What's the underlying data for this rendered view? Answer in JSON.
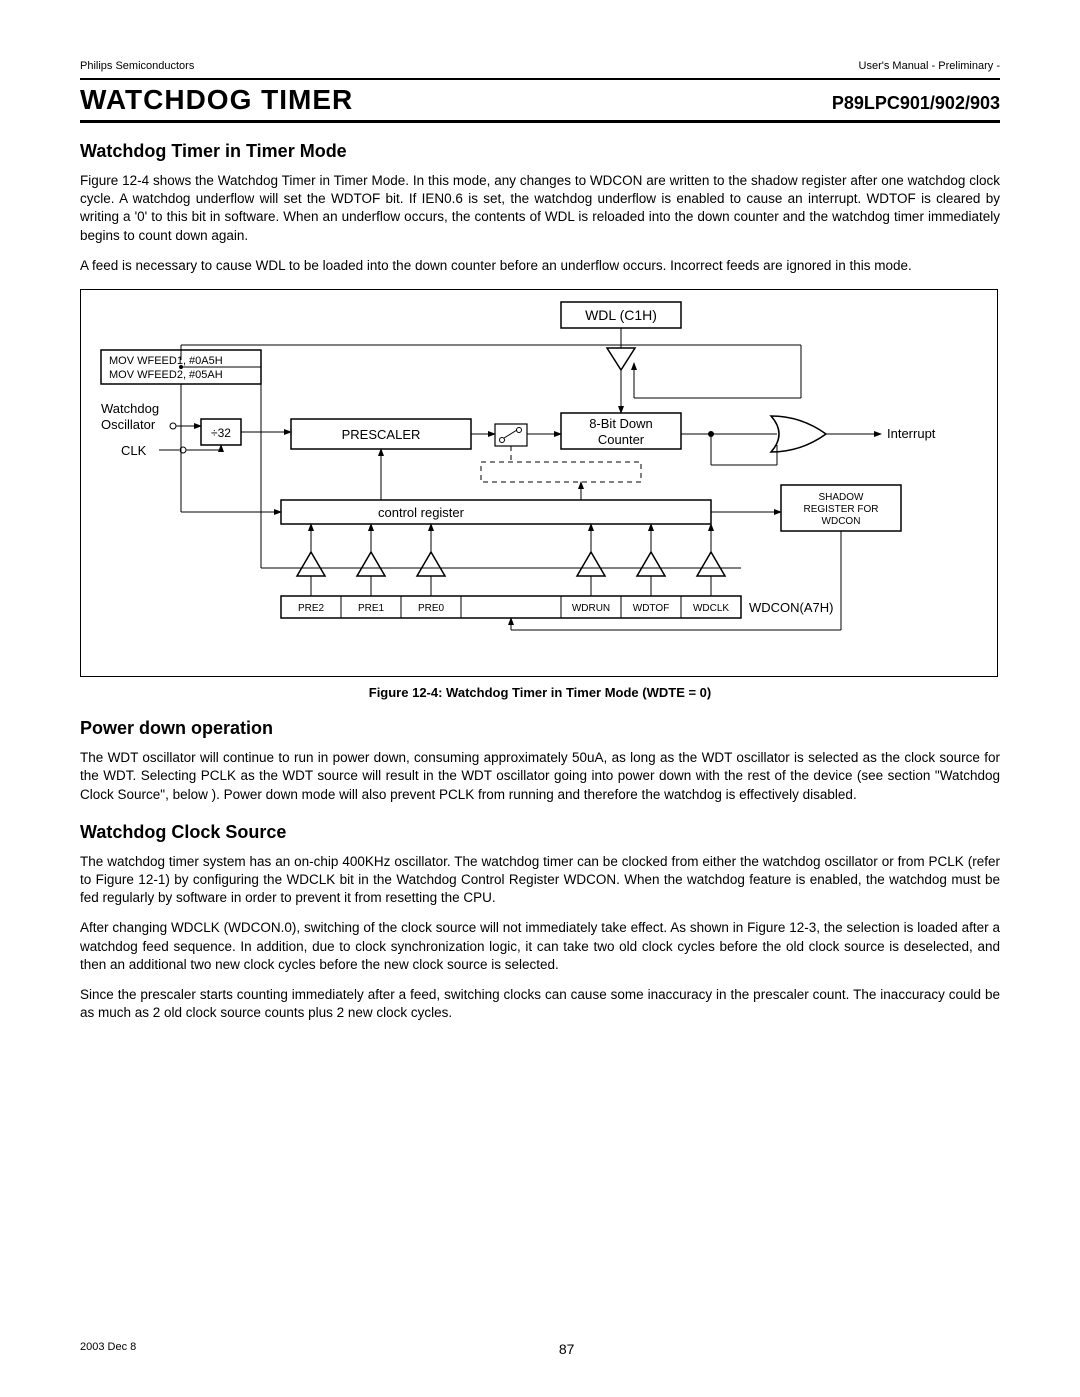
{
  "header": {
    "left": "Philips Semiconductors",
    "right": "User's Manual - Preliminary -"
  },
  "titlebar": {
    "main": "WATCHDOG TIMER",
    "part": "P89LPC901/902/903"
  },
  "sections": {
    "s1_title": "Watchdog Timer in Timer Mode",
    "s1_p1": "Figure 12-4 shows the Watchdog Timer in Timer Mode. In this mode, any changes to WDCON are written to the shadow register after one watchdog clock cycle. A watchdog underflow will set the WDTOF bit. If IEN0.6 is set, the watchdog underflow is enabled to cause an interrupt. WDTOF is cleared by writing a '0' to this bit in software. When an underflow occurs, the contents of WDL is reloaded into the down counter and the watchdog timer immediately begins to count down again.",
    "s1_p2": "A feed is necessary to cause WDL to be loaded into the down counter before an underflow occurs. Incorrect feeds are ignored in this mode.",
    "fig_caption": "Figure 12-4: Watchdog Timer in Timer Mode (WDTE = 0)",
    "s2_title": "Power down operation",
    "s2_p1": "The WDT oscillator will continue to run in power down, consuming approximately 50uA, as long as the WDT oscillator is selected as the clock source for the WDT.  Selecting PCLK as the WDT source will result in the WDT oscillator going into power down with the rest of the device (see section \"Watchdog Clock Source\", below ). Power down mode will also prevent PCLK from running and therefore the watchdog is effectively disabled.",
    "s3_title": "Watchdog Clock Source",
    "s3_p1": "The watchdog timer system has an on-chip 400KHz oscillator. The watchdog timer can be clocked from either the watchdog oscillator or from PCLK (refer to Figure 12-1) by configuring the WDCLK bit in the Watchdog Control Register WDCON. When the watchdog feature is enabled, the watchdog must be fed regularly by software in order to prevent it from resetting the CPU.",
    "s3_p2": "After changing WDCLK (WDCON.0), switching of the clock source will not immediately take effect. As shown in Figure 12-3, the selection is loaded after a watchdog feed sequence. In addition, due to clock synchronization logic, it can take two old clock cycles before the old clock source is deselected, and then an additional two new clock cycles before the new clock source is selected.",
    "s3_p3": "Since the prescaler starts counting immediately after a feed, switching clocks can cause some inaccuracy in the prescaler count. The inaccuracy could be as much as 2 old clock source counts plus 2 new clock cycles."
  },
  "diagram": {
    "wdl": "WDL (C1H)",
    "mov1": "MOV WFEED1, #0A5H",
    "mov2": "MOV WFEED2, #05AH",
    "osc1": "Watchdog",
    "osc2": "Oscillator",
    "clk": "CLK",
    "div32": "÷32",
    "prescaler": "PRESCALER",
    "counter1": "8-Bit Down",
    "counter2": "Counter",
    "interrupt": "Interrupt",
    "shadow1": "SHADOW",
    "shadow2": "REGISTER FOR",
    "shadow3": "WDCON",
    "ctrlreg": "control register",
    "pre2": "PRE2",
    "pre1": "PRE1",
    "pre0": "PRE0",
    "wdrun": "WDRUN",
    "wdtof": "WDTOF",
    "wdclk": "WDCLK",
    "wdcon": "WDCON(A7H)"
  },
  "footer": {
    "date": "2003 Dec 8",
    "page": "87"
  }
}
